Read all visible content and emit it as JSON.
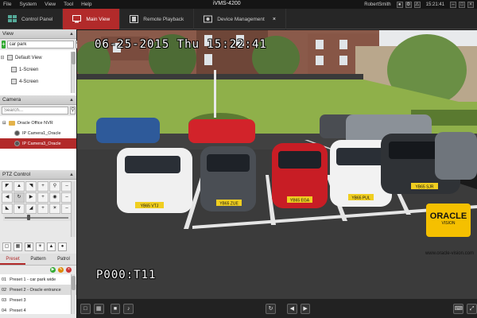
{
  "menubar": {
    "items": [
      "File",
      "System",
      "View",
      "Tool",
      "Help"
    ],
    "app_title": "iVMS-4200",
    "user": "RobertSmith",
    "time": "15:21:41"
  },
  "tabs": [
    {
      "label": "Control Panel"
    },
    {
      "label": "Main View"
    },
    {
      "label": "Remote Playback"
    },
    {
      "label": "Device Management"
    }
  ],
  "view_panel": {
    "header": "View",
    "search_value": "car park",
    "tree": [
      {
        "label": "Default View"
      },
      {
        "label": "1-Screen"
      },
      {
        "label": "4-Screen"
      }
    ]
  },
  "camera_panel": {
    "header": "Camera",
    "search_placeholder": "Search...",
    "tree": [
      {
        "label": "Oracle Office NVR"
      },
      {
        "label": "IP Camera1_Oracle"
      },
      {
        "label": "IP Camera3_Oracle"
      }
    ]
  },
  "ptz_panel": {
    "header": "PTZ Control",
    "tabs": [
      "Preset",
      "Pattern",
      "Patrol"
    ],
    "presets": [
      {
        "num": "01",
        "label": "Preset 1 - car park wide"
      },
      {
        "num": "02",
        "label": "Preset 2 - Oracle entrance"
      },
      {
        "num": "03",
        "label": "Preset 3"
      },
      {
        "num": "04",
        "label": "Preset 4"
      }
    ]
  },
  "video": {
    "osd_datetime": "06-25-2015 Thu 15:22:41",
    "osd_ptz": "P000:T11",
    "logo_text": "ORACLE",
    "logo_subtext": "VISION",
    "watermark_url": "www.oracle-vision.com",
    "plates": [
      "YB65 VTJ",
      "YB65 ZUE",
      "YB65 EGA",
      "YB65 PUL",
      "YB65 SJR"
    ]
  },
  "colors": {
    "accent": "#b22a2a",
    "logo": "#f5c000"
  }
}
